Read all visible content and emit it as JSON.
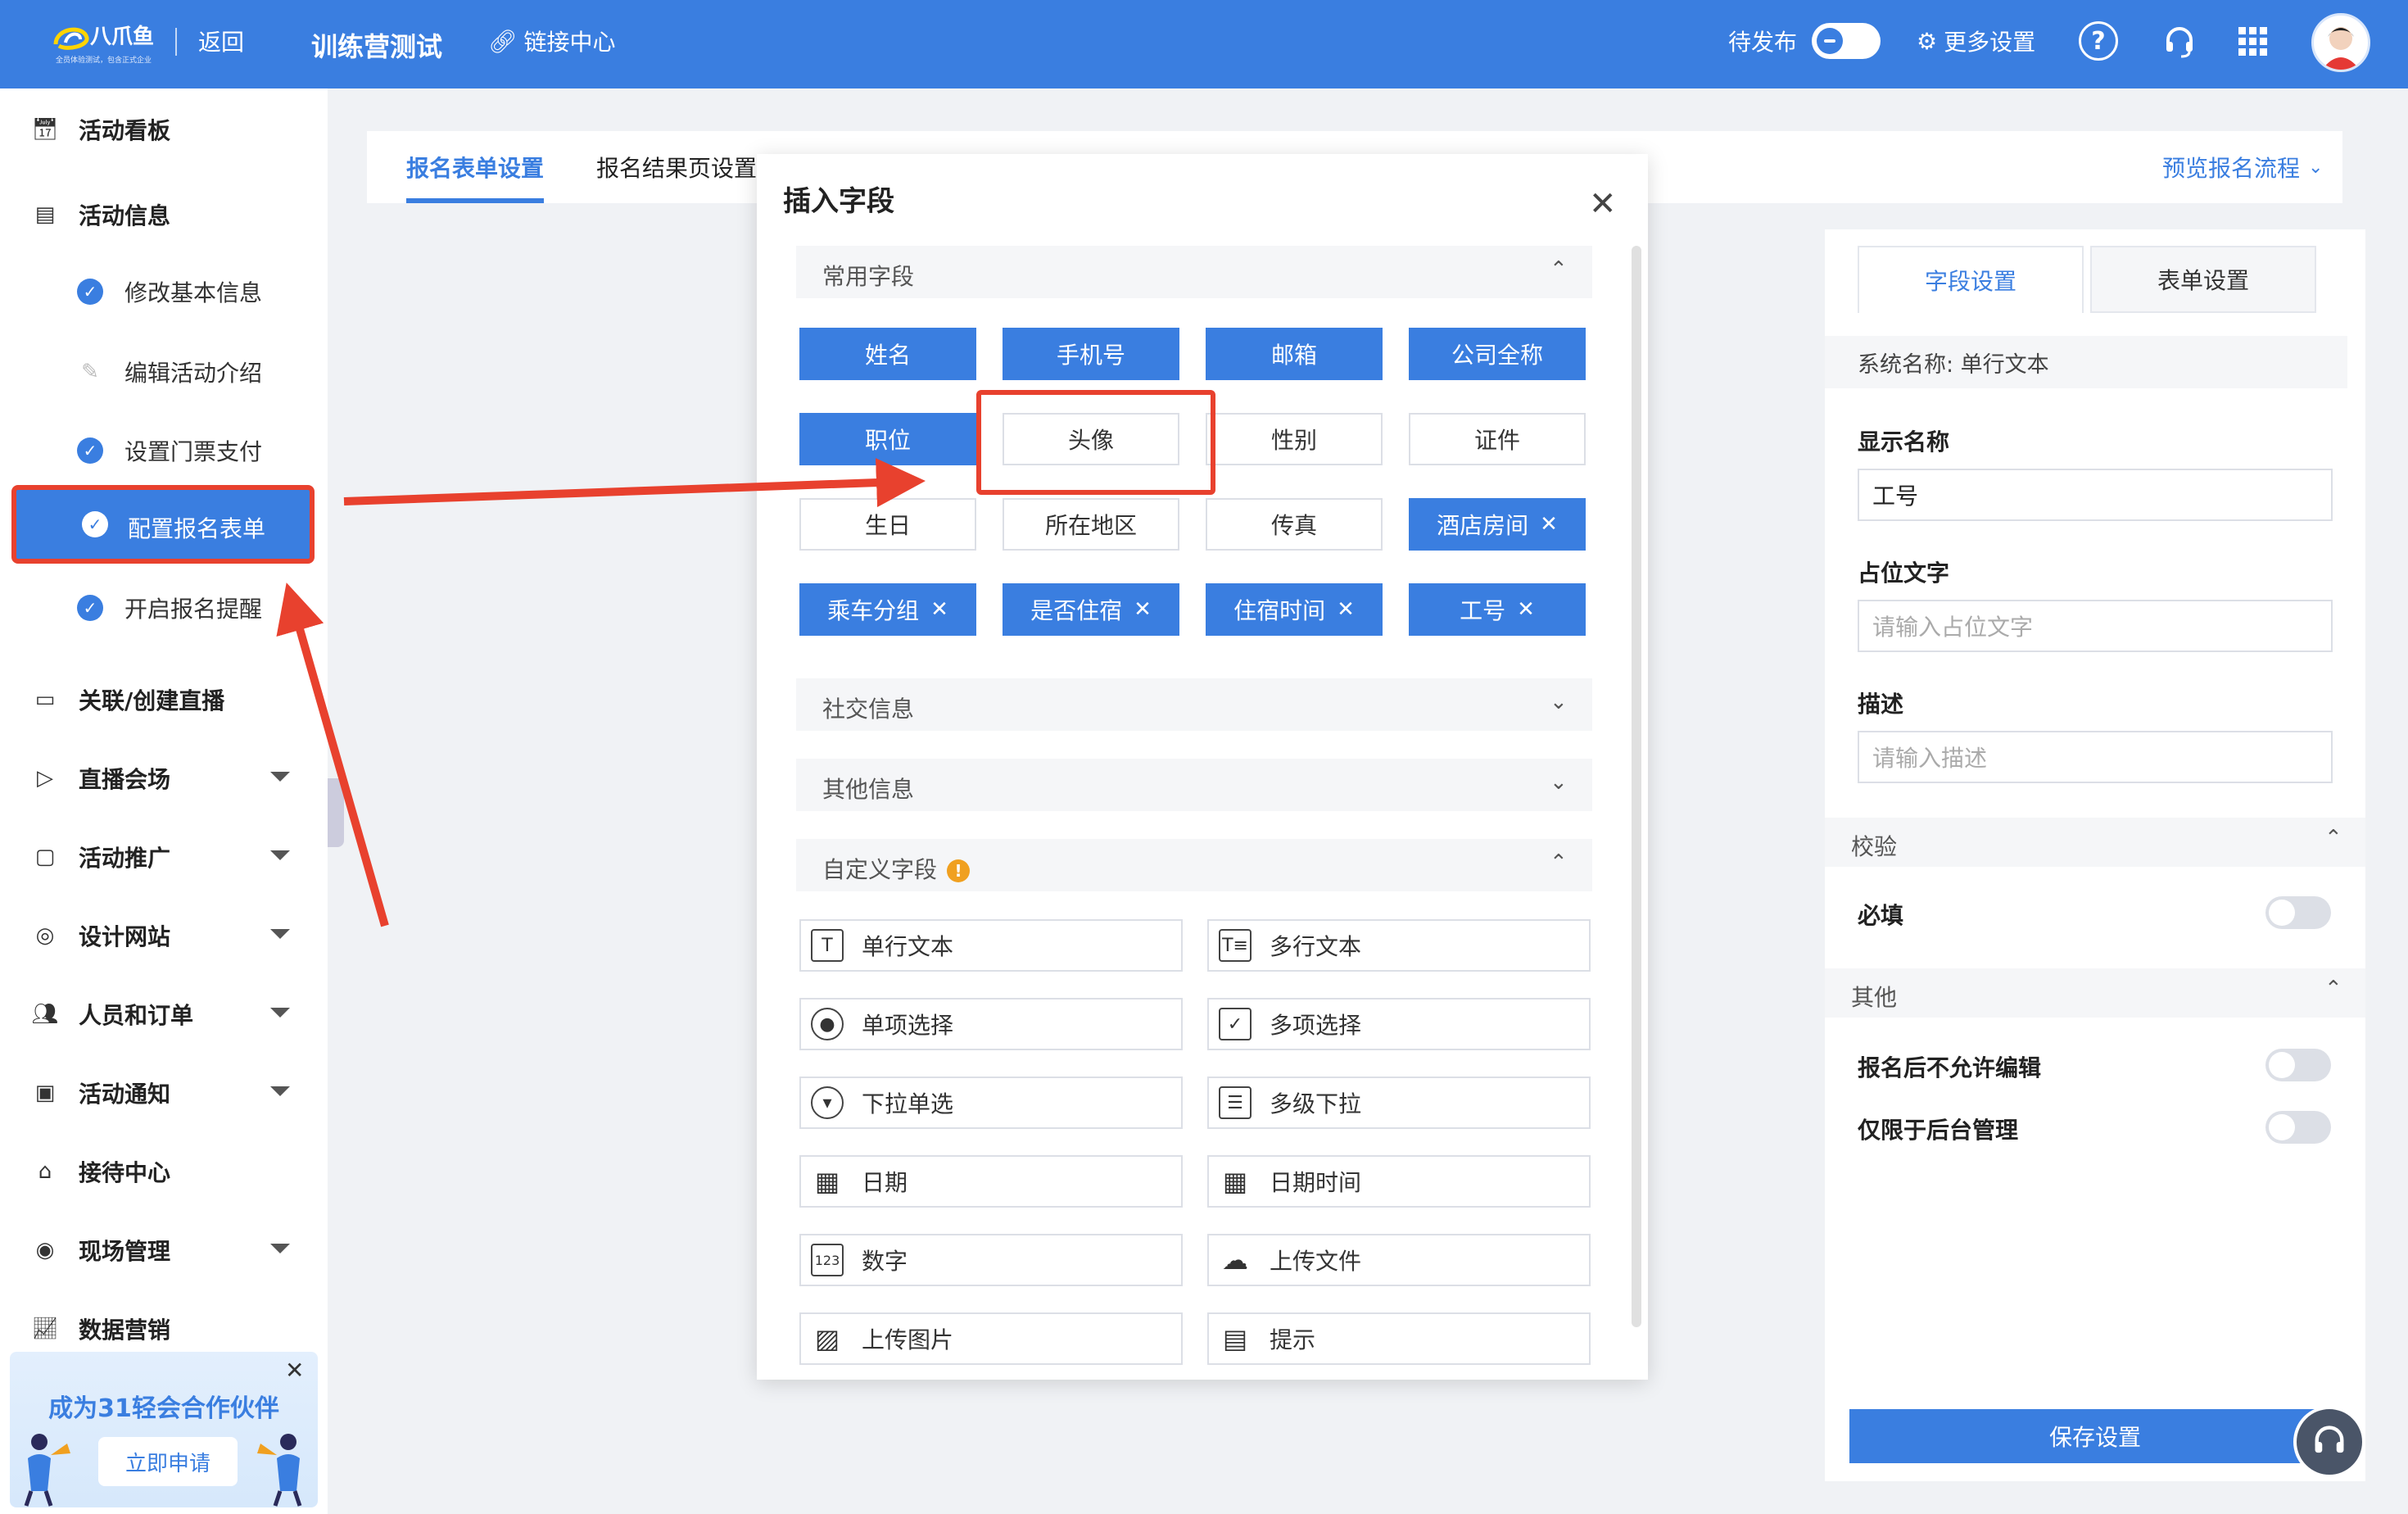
{
  "topbar": {
    "logo_text": "八爪鱼",
    "logo_sub": "全员体验测试，包含正式企业",
    "back": "返回",
    "title": "训练营测试",
    "link_center": "链接中心",
    "pending": "待发布",
    "more_settings": "更多设置",
    "help": "?"
  },
  "sidebar": {
    "items": [
      {
        "label": "活动看板",
        "icon": "dashboard-icon"
      },
      {
        "label": "活动信息",
        "icon": "document-icon"
      },
      {
        "label": "关联/创建直播",
        "icon": "video-icon"
      },
      {
        "label": "直播会场",
        "icon": "monitor-play-icon"
      },
      {
        "label": "活动推广",
        "icon": "cast-icon"
      },
      {
        "label": "设计网站",
        "icon": "compass-icon"
      },
      {
        "label": "人员和订单",
        "icon": "people-icon"
      },
      {
        "label": "活动通知",
        "icon": "chat-icon"
      },
      {
        "label": "接待中心",
        "icon": "reception-icon"
      },
      {
        "label": "现场管理",
        "icon": "target-icon"
      },
      {
        "label": "数据营销",
        "icon": "chart-icon"
      }
    ],
    "sub_items": [
      {
        "label": "修改基本信息"
      },
      {
        "label": "编辑活动介绍"
      },
      {
        "label": "设置门票支付"
      },
      {
        "label": "配置报名表单"
      },
      {
        "label": "开启报名提醒"
      }
    ]
  },
  "promo": {
    "title": "成为31轻会合作伙伴",
    "button": "立即申请"
  },
  "tabs": {
    "tab1": "报名表单设置",
    "tab2": "报名结果页设置",
    "preview": "预览报名流程"
  },
  "modal": {
    "title": "插入字段",
    "sections": {
      "common": "常用字段",
      "social": "社交信息",
      "other": "其他信息",
      "custom": "自定义字段"
    },
    "common_fields": [
      {
        "label": "姓名"
      },
      {
        "label": "手机号"
      },
      {
        "label": "邮箱"
      },
      {
        "label": "公司全称"
      },
      {
        "label": "职位"
      },
      {
        "label": "头像"
      },
      {
        "label": "性别"
      },
      {
        "label": "证件"
      },
      {
        "label": "生日"
      },
      {
        "label": "所在地区"
      },
      {
        "label": "传真"
      },
      {
        "label": "酒店房间"
      },
      {
        "label": "乘车分组"
      },
      {
        "label": "是否住宿"
      },
      {
        "label": "住宿时间"
      },
      {
        "label": "工号"
      }
    ],
    "custom_fields": [
      {
        "label": "单行文本",
        "icon": "text-field-icon"
      },
      {
        "label": "多行文本",
        "icon": "textarea-icon"
      },
      {
        "label": "单项选择",
        "icon": "radio-icon"
      },
      {
        "label": "多项选择",
        "icon": "checkbox-icon"
      },
      {
        "label": "下拉单选",
        "icon": "dropdown-icon"
      },
      {
        "label": "多级下拉",
        "icon": "cascade-icon"
      },
      {
        "label": "日期",
        "icon": "calendar-icon"
      },
      {
        "label": "日期时间",
        "icon": "calendar-clock-icon"
      },
      {
        "label": "数字",
        "icon": "number-icon"
      },
      {
        "label": "上传文件",
        "icon": "upload-cloud-icon"
      },
      {
        "label": "上传图片",
        "icon": "image-icon"
      },
      {
        "label": "提示",
        "icon": "notice-icon"
      }
    ]
  },
  "right_panel": {
    "tab_field": "字段设置",
    "tab_form": "表单设置",
    "system_name": "系统名称: 单行文本",
    "display_name_label": "显示名称",
    "display_name_value": "工号",
    "placeholder_label": "占位文字",
    "placeholder_placeholder": "请输入占位文字",
    "desc_label": "描述",
    "desc_placeholder": "请输入描述",
    "validate_section": "校验",
    "required_label": "必填",
    "other_section": "其他",
    "no_edit_label": "报名后不允许编辑",
    "backend_only_label": "仅限于后台管理",
    "save_button": "保存设置"
  },
  "colors": {
    "primary": "#3a7ee0",
    "highlight_red": "#e8412e",
    "warning": "#f0a020"
  }
}
